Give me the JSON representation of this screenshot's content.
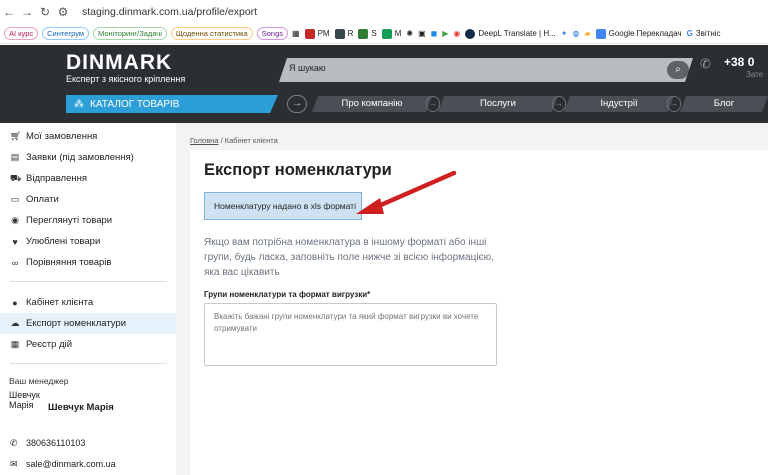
{
  "browser": {
    "url": "staging.dinmark.com.ua/profile/export",
    "bookmarks": [
      "AI курс",
      "Синтегрум",
      "Моніторинг/Задачі",
      "Щоденна статистика",
      "Songs",
      "PM",
      "R",
      "S",
      "M",
      "DeepL Translate | H...",
      "Google Перекладач",
      "Звітніс"
    ]
  },
  "header": {
    "logo": "DINMARK",
    "slogan": "Експерт з якісного кріплення",
    "search_placeholder": "Я шукаю",
    "phone": "+38 0",
    "phone_sub": "Зате",
    "catalog_label": "КАТАЛОГ ТОВАРІВ",
    "nav": [
      "Про компанію",
      "Послуги",
      "Індустрії",
      "Блог"
    ]
  },
  "sidebar": {
    "items_top": [
      "Мої замовлення",
      "Заявки (під замовлення)",
      "Відправлення",
      "Оплати",
      "Переглянуті товари",
      "Улюблені товари",
      "Порівняння товарів"
    ],
    "items_bottom": [
      "Кабінет клієнта",
      "Експорт номенклатури",
      "Реєстр дій"
    ],
    "manager": {
      "title": "Ваш менеджер",
      "avatar_alt": "Шевчук Марія",
      "name": "Шевчук Марія",
      "phone": "380636110103",
      "email": "sale@dinmark.com.ua"
    }
  },
  "main": {
    "breadcrumb_home": "Головна",
    "breadcrumb_current": "Кабінет клієнта",
    "title": "Експорт номенклатури",
    "notice": "Номенклатуру надано в xls форматі",
    "description": "Якщо вам потрібна номенклатура в іншому форматі або інші групи, будь ласка, заповніть поле нижче зі всією інформацією, яка вас цікавить",
    "field_label": "Групи номенклатури та формат вигрузки*",
    "textarea_placeholder": "Вкажіть бажані групи номенклатури та який формат вигрузки ви хочете отримувати"
  },
  "colors": {
    "header_bg": "#2b2f34",
    "accent": "#2d9fd8",
    "arrow": "#d01f1f"
  }
}
